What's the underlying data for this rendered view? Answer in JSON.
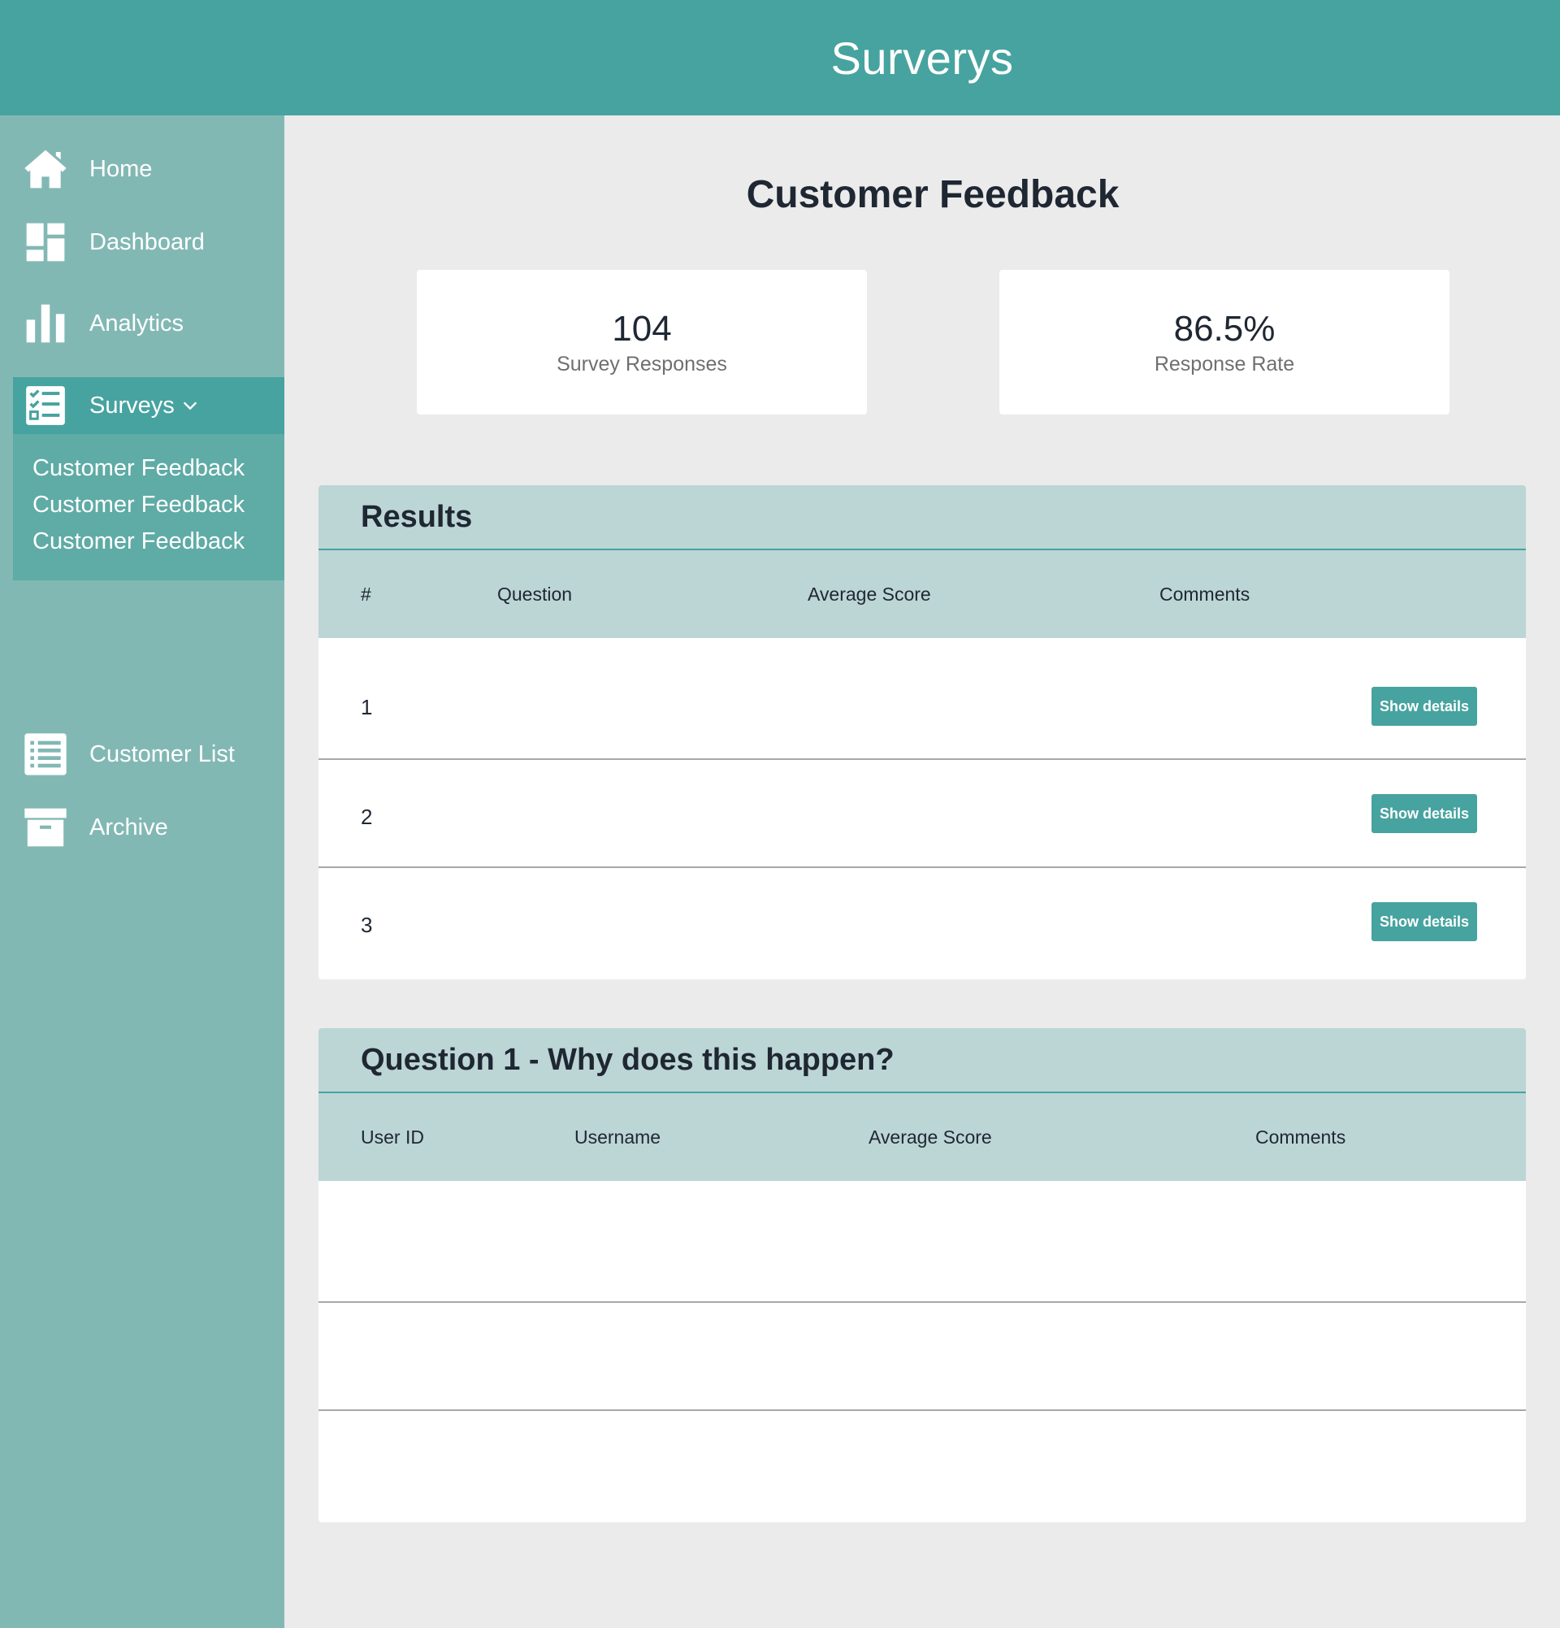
{
  "app": {
    "title": "Surverys"
  },
  "sidebar": {
    "home": "Home",
    "dashboard": "Dashboard",
    "analytics": "Analytics",
    "surveys": "Surveys",
    "survey_items": [
      "Customer Feedback",
      "Customer Feedback",
      "Customer Feedback"
    ],
    "customer_list": "Customer List",
    "archive": "Archive"
  },
  "main": {
    "title": "Customer Feedback",
    "stats": [
      {
        "value": "104",
        "caption": "Survey Responses"
      },
      {
        "value": "86.5%",
        "caption": "Response Rate"
      }
    ],
    "results": {
      "title": "Results",
      "columns": [
        "#",
        "Question",
        "Average Score",
        "Comments"
      ],
      "rows": [
        {
          "num": "1",
          "button": "Show details"
        },
        {
          "num": "2",
          "button": "Show details"
        },
        {
          "num": "3",
          "button": "Show details"
        }
      ]
    },
    "question": {
      "title": "Question 1 - Why does this happen?",
      "columns": [
        "User ID",
        "Username",
        "Average Score",
        "Comments"
      ]
    }
  },
  "colors": {
    "accent": "#47a39f",
    "sidebar": "#82b8b4",
    "table_header": "#bcd5d5"
  }
}
